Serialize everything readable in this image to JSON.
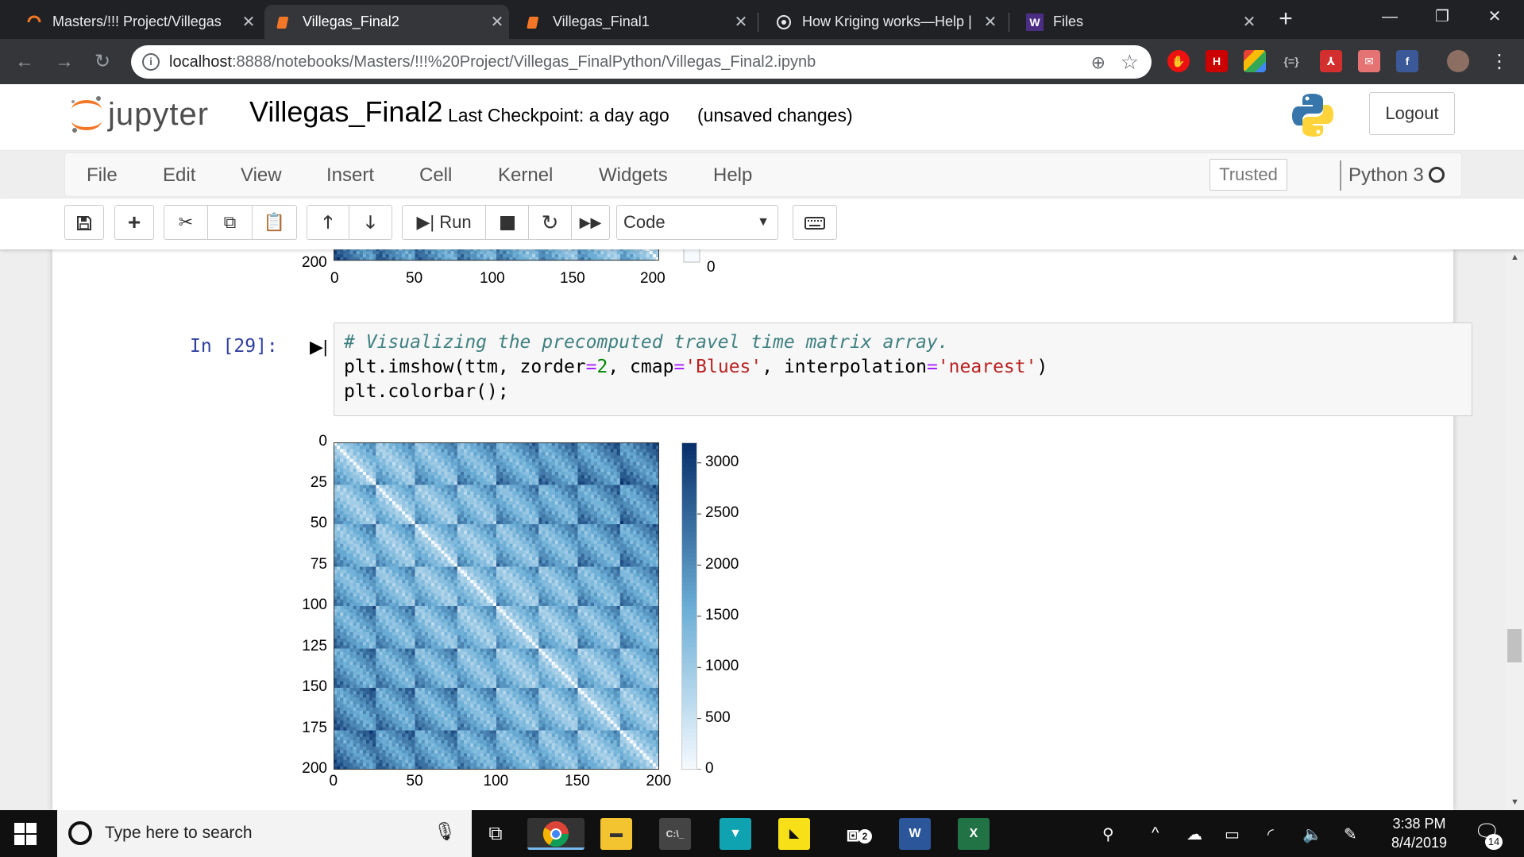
{
  "browser": {
    "tabs": [
      {
        "title": "Masters/!!! Project/Villegas",
        "active": false
      },
      {
        "title": "Villegas_Final2",
        "active": true
      },
      {
        "title": "Villegas_Final1",
        "active": false
      },
      {
        "title": "How Kriging works—Help |",
        "active": false
      },
      {
        "title": "Files",
        "active": false
      }
    ],
    "new_tab_label": "+",
    "url_host": "localhost",
    "url_path": ":8888/notebooks/Masters/!!!%20Project/Villegas_FinalPython/Villegas_Final2.ipynb"
  },
  "jupyter": {
    "logo_text": "jupyter",
    "notebook_name": "Villegas_Final2",
    "checkpoint": "Last Checkpoint: a day ago",
    "unsaved": "(unsaved changes)",
    "logout_label": "Logout",
    "menu": [
      "File",
      "Edit",
      "View",
      "Insert",
      "Cell",
      "Kernel",
      "Widgets",
      "Help"
    ],
    "trusted_label": "Trusted",
    "kernel_name": "Python 3",
    "toolbar": {
      "run_label": "Run",
      "cell_type": "Code",
      "icons": [
        "save-icon",
        "plus-icon",
        "cut-icon",
        "copy-icon",
        "paste-icon",
        "arrow-up-icon",
        "arrow-down-icon",
        "run-icon",
        "stop-icon",
        "restart-icon",
        "fast-forward-icon",
        "keyboard-icon"
      ]
    }
  },
  "cell": {
    "prompt": "In [29]:",
    "code_lines": [
      "# Visualizing the precomputed travel time matrix array.",
      "plt.imshow(ttm, zorder=2, cmap='Blues', interpolation='nearest')",
      "plt.colorbar();"
    ]
  },
  "chart_data": [
    {
      "type": "heatmap",
      "partially_visible": true,
      "x_ticks": [
        "0",
        "50",
        "100",
        "150",
        "200"
      ],
      "y_ticks_visible": [
        "200"
      ],
      "colorbar_ticks_visible": [
        "0"
      ],
      "cmap": "Blues"
    },
    {
      "type": "heatmap",
      "description_values": "201x201 travel time matrix, zero diagonal, periodic block structure every ~25 units",
      "x_ticks": [
        "0",
        "50",
        "100",
        "150",
        "200"
      ],
      "y_ticks": [
        "0",
        "25",
        "50",
        "75",
        "100",
        "125",
        "150",
        "175",
        "200"
      ],
      "xlim": [
        0,
        200
      ],
      "ylim": [
        200,
        0
      ],
      "colorbar": {
        "ticks": [
          "0",
          "500",
          "1000",
          "1500",
          "2000",
          "2500",
          "3000"
        ],
        "range": [
          0,
          3200
        ]
      },
      "cmap": "Blues",
      "colors": {
        "low": "#f7fbff",
        "mid": "#6baed6",
        "high": "#08306b"
      }
    }
  ],
  "taskbar": {
    "search_placeholder": "Type here to search",
    "time": "3:38 PM",
    "date": "8/4/2019",
    "notifications": "14",
    "apps": [
      "chrome-icon",
      "file-explorer-icon",
      "terminal-icon",
      "app-icon",
      "sticky-notes-icon",
      "task-view-icon",
      "word-icon",
      "excel-icon"
    ],
    "badge": "2"
  }
}
